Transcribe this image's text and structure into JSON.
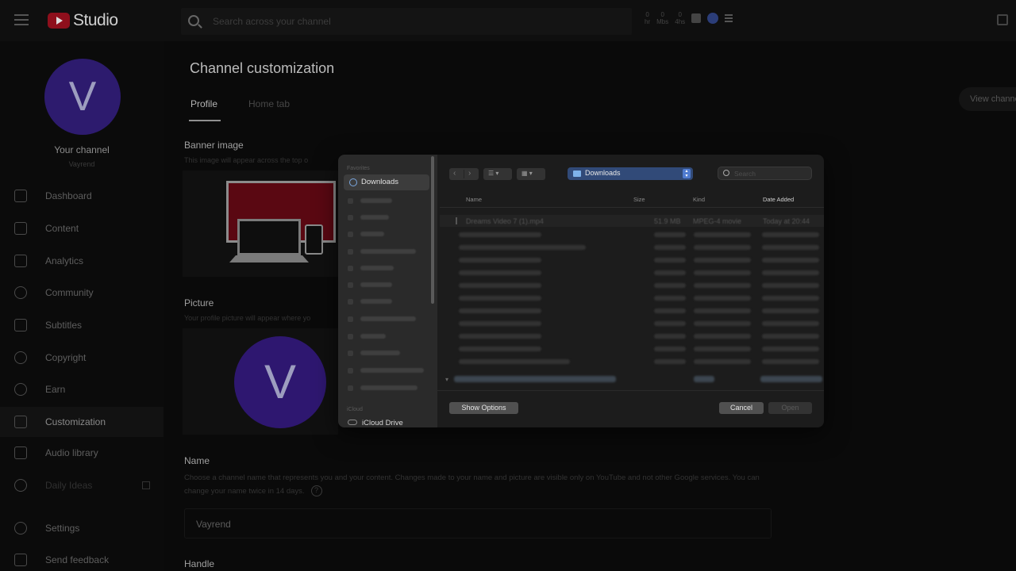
{
  "header": {
    "app_name": "Studio",
    "search_placeholder": "Search across your channel",
    "stats": [
      {
        "value": "0",
        "unit": "hr"
      },
      {
        "value": "0",
        "unit": "Mbs"
      },
      {
        "value": "0",
        "unit": "4hs"
      }
    ]
  },
  "sidebar": {
    "avatar_letter": "V",
    "channel_title": "Your channel",
    "channel_name": "Vayrend",
    "items": [
      {
        "label": "Dashboard",
        "icon": "dashboard-icon"
      },
      {
        "label": "Content",
        "icon": "content-icon"
      },
      {
        "label": "Analytics",
        "icon": "analytics-icon"
      },
      {
        "label": "Community",
        "icon": "community-icon"
      },
      {
        "label": "Subtitles",
        "icon": "subtitles-icon"
      },
      {
        "label": "Copyright",
        "icon": "copyright-icon"
      },
      {
        "label": "Earn",
        "icon": "earn-icon"
      },
      {
        "label": "Customization",
        "icon": "customization-icon",
        "active": true
      },
      {
        "label": "Audio library",
        "icon": "audio-library-icon"
      },
      {
        "label": "Daily Ideas",
        "icon": "daily-ideas-icon"
      },
      {
        "label": "Settings",
        "icon": "settings-icon"
      },
      {
        "label": "Send feedback",
        "icon": "feedback-icon"
      }
    ]
  },
  "main": {
    "title": "Channel customization",
    "tabs": [
      "Profile",
      "Home tab"
    ],
    "active_tab": "Profile",
    "view_channel": "View channel",
    "banner": {
      "label": "Banner image",
      "desc": "This image will appear across the top o"
    },
    "picture": {
      "label": "Picture",
      "desc": "Your profile picture will appear where yo",
      "letter": "V"
    },
    "name": {
      "label": "Name",
      "desc": "Choose a channel name that represents you and your content. Changes made to your name and picture are visible only on YouTube and not other Google services. You can change your name twice in 14 days.",
      "help": "?",
      "value": "Vayrend"
    },
    "handle": {
      "label": "Handle"
    }
  },
  "dialog": {
    "favorites_heading": "Favorites",
    "favorites_active": "Downloads",
    "icloud_heading": "iCloud",
    "icloud_item": "iCloud Drive",
    "location": "Downloads",
    "search_placeholder": "Search",
    "view_list_glyph": "☰ ▾",
    "view_group_glyph": "▦ ▾",
    "columns": {
      "name": "Name",
      "size": "Size",
      "kind": "Kind",
      "date": "Date Added"
    },
    "first_file": {
      "name": "Dreams Video 7 (1).mp4",
      "size": "51.9 MB",
      "kind": "MPEG-4 movie",
      "date": "Today at 20:44"
    },
    "buttons": {
      "options": "Show Options",
      "cancel": "Cancel",
      "open": "Open"
    }
  }
}
